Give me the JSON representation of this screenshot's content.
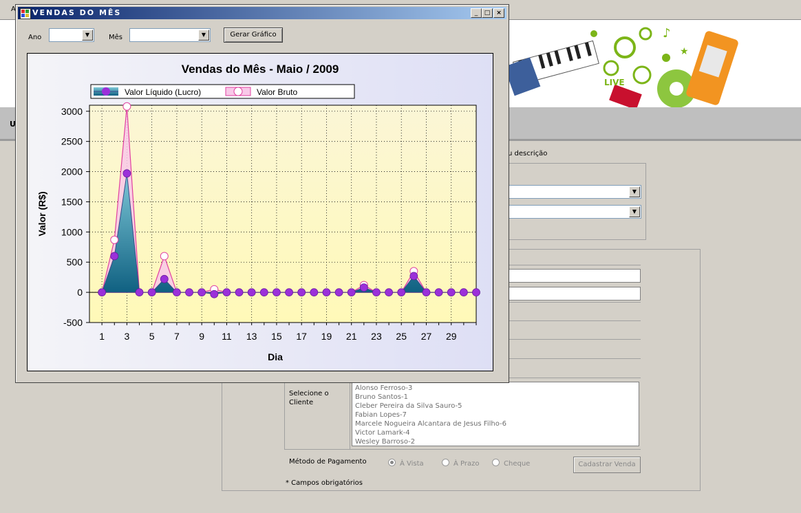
{
  "background_app": {
    "top_letter": "A",
    "nav_letter": "U",
    "desc_hint": "u descrição",
    "client_label": "Selecione o Cliente",
    "clients": [
      "Alonso Ferroso-3",
      "Bruno Santos-1",
      "Cleber Pereira da Silva Sauro-5",
      "Fabian Lopes-7",
      "Marcele Nogueira Alcantara de Jesus Filho-6",
      "Victor Lamark-4",
      "Wesley Barroso-2"
    ],
    "payment_label": "Método de Pagamento",
    "payment_options": [
      "À Vista",
      "À Prazo",
      "Cheque"
    ],
    "payment_selected": "À Vista",
    "submit_label": "Cadastrar Venda",
    "required_note": "* Campos obrigatórios"
  },
  "dialog": {
    "title": "VENDAS DO MÊS",
    "ano_label": "Ano",
    "ano_value": "",
    "mes_label": "Mês",
    "mes_value": "",
    "button_label": "Gerar Gráfico"
  },
  "colors": {
    "titlebar_start": "#0a246a",
    "titlebar_end": "#a6caf0",
    "liquido_marker": "#9b30d9",
    "liquido_fill_top": "#7ec8d8",
    "liquido_fill_bottom": "#0e5f80",
    "bruto_line": "#e040a0",
    "bruto_fill": "#f8c8e8"
  },
  "chart_data": {
    "type": "area",
    "title": "Vendas do Mês - Maio / 2009",
    "xlabel": "Dia",
    "ylabel": "Valor (R$)",
    "xlim": [
      0,
      31
    ],
    "ylim": [
      -500,
      3100
    ],
    "xticks": [
      1,
      3,
      5,
      7,
      9,
      11,
      13,
      15,
      17,
      19,
      21,
      23,
      25,
      27,
      29
    ],
    "yticks": [
      -500,
      0,
      500,
      1000,
      1500,
      2000,
      2500,
      3000
    ],
    "grid": true,
    "legend_position": "top",
    "x": [
      1,
      2,
      3,
      4,
      5,
      6,
      7,
      8,
      9,
      10,
      11,
      12,
      13,
      14,
      15,
      16,
      17,
      18,
      19,
      20,
      21,
      22,
      23,
      24,
      25,
      26,
      27,
      28,
      29,
      30,
      31
    ],
    "series": [
      {
        "name": "Valor Líquido (Lucro)",
        "values": [
          0,
          600,
          1970,
          0,
          0,
          220,
          0,
          0,
          0,
          -30,
          0,
          0,
          0,
          0,
          0,
          0,
          0,
          0,
          0,
          0,
          0,
          80,
          0,
          0,
          0,
          270,
          0,
          0,
          0,
          0,
          0
        ]
      },
      {
        "name": "Valor Bruto",
        "values": [
          0,
          870,
          3080,
          0,
          0,
          600,
          0,
          0,
          0,
          50,
          0,
          0,
          0,
          0,
          0,
          0,
          0,
          0,
          0,
          0,
          0,
          120,
          0,
          0,
          0,
          350,
          0,
          0,
          0,
          0,
          0
        ]
      }
    ]
  }
}
